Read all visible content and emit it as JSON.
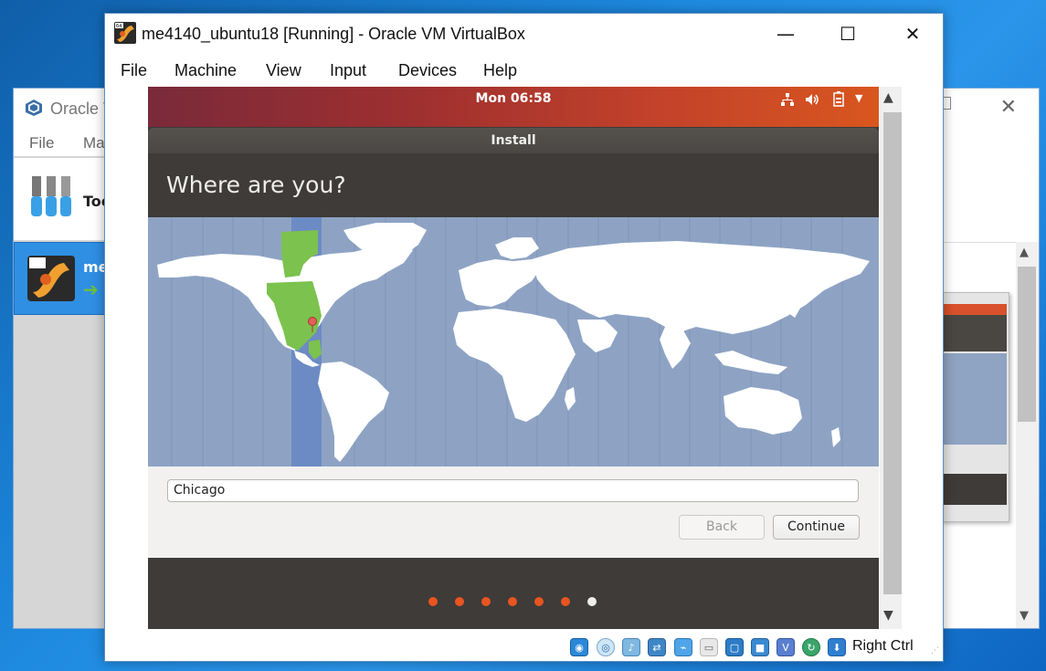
{
  "background_window": {
    "title": "Oracle V",
    "menu": [
      "File",
      "Ma"
    ],
    "tools_label": "Too",
    "vm_item_label": "me"
  },
  "window": {
    "title": "me4140_ubuntu18 [Running] - Oracle VM VirtualBox",
    "icon_badge": "64",
    "minimize_glyph": "—",
    "maximize_glyph": "☐",
    "close_glyph": "✕"
  },
  "menu": [
    "File",
    "Machine",
    "View",
    "Input",
    "Devices",
    "Help"
  ],
  "guest": {
    "panel": {
      "clock": "Mon 06:58",
      "indicators": [
        "network-icon",
        "volume-icon",
        "battery-icon",
        "dropdown-icon"
      ]
    },
    "installer": {
      "window_title": "Install",
      "heading": "Where are you?",
      "timezone_input_value": "Chicago",
      "back_label": "Back",
      "continue_label": "Continue",
      "progress": {
        "total_steps": 7,
        "completed_steps": 6
      },
      "colors": {
        "accent": "#e95420",
        "dot_inactive": "#eeeeec",
        "map_ocean": "#8ea3c4",
        "timezone_highlight": "#7cc24e"
      }
    }
  },
  "statusbar": {
    "icons": [
      "hard-disk-icon",
      "optical-disk-icon",
      "audio-icon",
      "network-icon",
      "usb-icon",
      "shared-folders-icon",
      "display-icon",
      "video-capture-icon",
      "virtualization-icon",
      "mouse-integration-icon",
      "keyboard-capture-icon"
    ],
    "host_key": "Right Ctrl"
  }
}
